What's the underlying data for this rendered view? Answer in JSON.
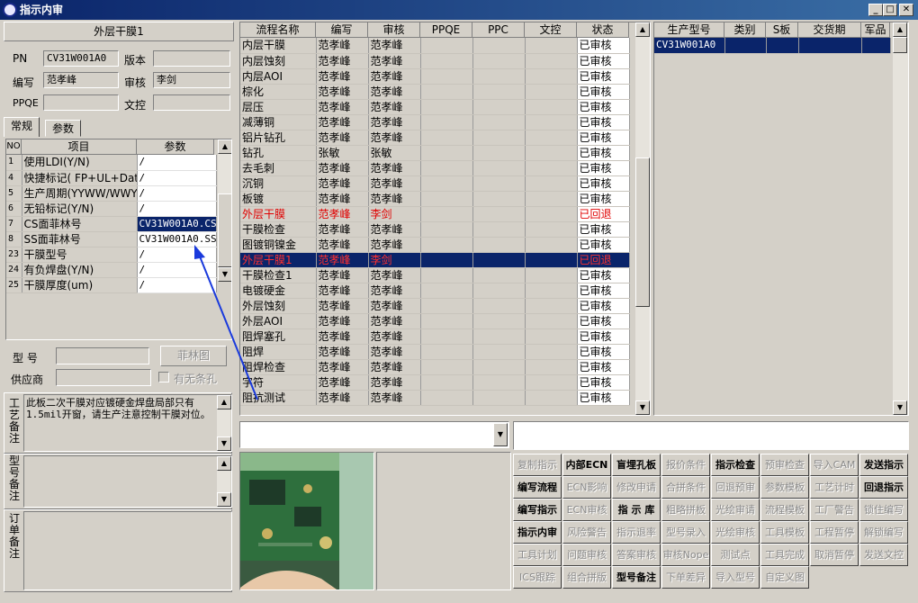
{
  "window": {
    "title": "指示内审"
  },
  "header": {
    "title": "外层干膜1"
  },
  "form": {
    "pn_label": "PN",
    "pn_value": "CV31W001A0",
    "version_label": "版本",
    "version_value": "",
    "author_label": "编写",
    "author_value": "范孝峰",
    "review_label": "审核",
    "review_value": "李剑",
    "ppqe_label": "PPQE",
    "ppqe_value": "",
    "control_label": "文控",
    "control_value": ""
  },
  "tabs": {
    "normal": "常规",
    "params": "参数"
  },
  "param_table": {
    "headers": [
      "NO",
      "项目",
      "参数"
    ],
    "rows": [
      {
        "no": "1",
        "item": "使用LDI(Y/N)",
        "value": "/"
      },
      {
        "no": "4",
        "item": "快捷标记( FP+UL+DateC",
        "value": "/"
      },
      {
        "no": "5",
        "item": "生产周期(YYWW/WWYY)",
        "value": "/"
      },
      {
        "no": "6",
        "item": "无铅标记(Y/N)",
        "value": "/"
      },
      {
        "no": "7",
        "item": "CS面菲林号",
        "value": "CV31W001A0.CS"
      },
      {
        "no": "8",
        "item": "SS面菲林号",
        "value": "CV31W001A0.SS"
      },
      {
        "no": "23",
        "item": "干膜型号",
        "value": "/"
      },
      {
        "no": "24",
        "item": "有负焊盘(Y/N)",
        "value": "/"
      },
      {
        "no": "25",
        "item": "干膜厚度(um)",
        "value": "/"
      }
    ]
  },
  "film": {
    "model_label": "型  号",
    "film_button": "菲林图",
    "supplier_label": "供应商",
    "no_strip_label": "有无条孔"
  },
  "remarks": {
    "process_label": "工艺备注",
    "process_text": "此板二次干膜对应镀硬金焊盘局部只有1.5mil开窗，请生产注意控制干膜对位。",
    "model_label": "型号备注",
    "model_text": "",
    "order_label": "订单备注",
    "order_text": ""
  },
  "flow_table": {
    "headers": [
      "流程名称",
      "编写",
      "审核",
      "PPQE",
      "PPC",
      "文控",
      "状态"
    ],
    "rows": [
      {
        "name": "内层干膜",
        "author": "范孝峰",
        "review": "范孝峰",
        "ppqe": "",
        "ppc": "",
        "ctrl": "",
        "status": "已审核",
        "style": "normal"
      },
      {
        "name": "内层蚀刻",
        "author": "范孝峰",
        "review": "范孝峰",
        "ppqe": "",
        "ppc": "",
        "ctrl": "",
        "status": "已审核",
        "style": "normal"
      },
      {
        "name": "内层AOI",
        "author": "范孝峰",
        "review": "范孝峰",
        "ppqe": "",
        "ppc": "",
        "ctrl": "",
        "status": "已审核",
        "style": "normal"
      },
      {
        "name": "棕化",
        "author": "范孝峰",
        "review": "范孝峰",
        "ppqe": "",
        "ppc": "",
        "ctrl": "",
        "status": "已审核",
        "style": "normal"
      },
      {
        "name": "层压",
        "author": "范孝峰",
        "review": "范孝峰",
        "ppqe": "",
        "ppc": "",
        "ctrl": "",
        "status": "已审核",
        "style": "normal"
      },
      {
        "name": "减薄铜",
        "author": "范孝峰",
        "review": "范孝峰",
        "ppqe": "",
        "ppc": "",
        "ctrl": "",
        "status": "已审核",
        "style": "normal"
      },
      {
        "name": "铝片钻孔",
        "author": "范孝峰",
        "review": "范孝峰",
        "ppqe": "",
        "ppc": "",
        "ctrl": "",
        "status": "已审核",
        "style": "normal"
      },
      {
        "name": "钻孔",
        "author": "张敏",
        "review": "张敏",
        "ppqe": "",
        "ppc": "",
        "ctrl": "",
        "status": "已审核",
        "style": "normal"
      },
      {
        "name": "去毛刺",
        "author": "范孝峰",
        "review": "范孝峰",
        "ppqe": "",
        "ppc": "",
        "ctrl": "",
        "status": "已审核",
        "style": "normal"
      },
      {
        "name": "沉铜",
        "author": "范孝峰",
        "review": "范孝峰",
        "ppqe": "",
        "ppc": "",
        "ctrl": "",
        "status": "已审核",
        "style": "normal"
      },
      {
        "name": "板镀",
        "author": "范孝峰",
        "review": "范孝峰",
        "ppqe": "",
        "ppc": "",
        "ctrl": "",
        "status": "已审核",
        "style": "normal"
      },
      {
        "name": "外层干膜",
        "author": "范孝峰",
        "review": "李剑",
        "ppqe": "",
        "ppc": "",
        "ctrl": "",
        "status": "已回退",
        "style": "red"
      },
      {
        "name": "干膜检查",
        "author": "范孝峰",
        "review": "范孝峰",
        "ppqe": "",
        "ppc": "",
        "ctrl": "",
        "status": "已审核",
        "style": "normal"
      },
      {
        "name": "图镀铜镍金",
        "author": "范孝峰",
        "review": "范孝峰",
        "ppqe": "",
        "ppc": "",
        "ctrl": "",
        "status": "已审核",
        "style": "normal"
      },
      {
        "name": "外层干膜1",
        "author": "范孝峰",
        "review": "李剑",
        "ppqe": "",
        "ppc": "",
        "ctrl": "",
        "status": "已回退",
        "style": "selected"
      },
      {
        "name": "干膜检查1",
        "author": "范孝峰",
        "review": "范孝峰",
        "ppqe": "",
        "ppc": "",
        "ctrl": "",
        "status": "已审核",
        "style": "normal"
      },
      {
        "name": "电镀硬金",
        "author": "范孝峰",
        "review": "范孝峰",
        "ppqe": "",
        "ppc": "",
        "ctrl": "",
        "status": "已审核",
        "style": "normal"
      },
      {
        "name": "外层蚀刻",
        "author": "范孝峰",
        "review": "范孝峰",
        "ppqe": "",
        "ppc": "",
        "ctrl": "",
        "status": "已审核",
        "style": "normal"
      },
      {
        "name": "外层AOI",
        "author": "范孝峰",
        "review": "范孝峰",
        "ppqe": "",
        "ppc": "",
        "ctrl": "",
        "status": "已审核",
        "style": "normal"
      },
      {
        "name": "阻焊塞孔",
        "author": "范孝峰",
        "review": "范孝峰",
        "ppqe": "",
        "ppc": "",
        "ctrl": "",
        "status": "已审核",
        "style": "normal"
      },
      {
        "name": "阻焊",
        "author": "范孝峰",
        "review": "范孝峰",
        "ppqe": "",
        "ppc": "",
        "ctrl": "",
        "status": "已审核",
        "style": "normal"
      },
      {
        "name": "阻焊检查",
        "author": "范孝峰",
        "review": "范孝峰",
        "ppqe": "",
        "ppc": "",
        "ctrl": "",
        "status": "已审核",
        "style": "normal"
      },
      {
        "name": "字符",
        "author": "范孝峰",
        "review": "范孝峰",
        "ppqe": "",
        "ppc": "",
        "ctrl": "",
        "status": "已审核",
        "style": "normal"
      },
      {
        "name": "阻抗测试",
        "author": "范孝峰",
        "review": "范孝峰",
        "ppqe": "",
        "ppc": "",
        "ctrl": "",
        "status": "已审核",
        "style": "normal"
      }
    ]
  },
  "order_table": {
    "headers": [
      "生产型号",
      "类别",
      "S板",
      "交货期",
      "军品"
    ],
    "rows": [
      {
        "model": "CV31W001A0",
        "type": "",
        "s": "",
        "due": "",
        "mil": ""
      }
    ]
  },
  "buttons": [
    {
      "label": "复制指示",
      "enabled": false
    },
    {
      "label": "内部ECN",
      "enabled": true
    },
    {
      "label": "盲埋孔板",
      "enabled": true
    },
    {
      "label": "报价条件",
      "enabled": false
    },
    {
      "label": "指示检查",
      "enabled": true
    },
    {
      "label": "预审检查",
      "enabled": false
    },
    {
      "label": "导入CAM",
      "enabled": false
    },
    {
      "label": "发送指示",
      "enabled": true
    },
    {
      "label": "编写流程",
      "enabled": true
    },
    {
      "label": "ECN影响",
      "enabled": false
    },
    {
      "label": "修改申请",
      "enabled": false
    },
    {
      "label": "合拼条件",
      "enabled": false
    },
    {
      "label": "回退预审",
      "enabled": false
    },
    {
      "label": "参数模板",
      "enabled": false
    },
    {
      "label": "工艺计时",
      "enabled": false
    },
    {
      "label": "回退指示",
      "enabled": true
    },
    {
      "label": "编写指示",
      "enabled": true
    },
    {
      "label": "ECN审核",
      "enabled": false
    },
    {
      "label": "指 示 库",
      "enabled": true
    },
    {
      "label": "粗略拼板",
      "enabled": false
    },
    {
      "label": "光绘审请",
      "enabled": false
    },
    {
      "label": "流程模板",
      "enabled": false
    },
    {
      "label": "工厂警告",
      "enabled": false
    },
    {
      "label": "锁住编写",
      "enabled": false
    },
    {
      "label": "指示内审",
      "enabled": true
    },
    {
      "label": "风险警告",
      "enabled": false
    },
    {
      "label": "指示退率",
      "enabled": false
    },
    {
      "label": "型号录入",
      "enabled": false
    },
    {
      "label": "光绘审核",
      "enabled": false
    },
    {
      "label": "工具模板",
      "enabled": false
    },
    {
      "label": "工程暂停",
      "enabled": false
    },
    {
      "label": "解锁编写",
      "enabled": false
    },
    {
      "label": "工具计划",
      "enabled": false
    },
    {
      "label": "问题审核",
      "enabled": false
    },
    {
      "label": "答案审核",
      "enabled": false
    },
    {
      "label": "审核Nope",
      "enabled": false
    },
    {
      "label": "测试点",
      "enabled": false
    },
    {
      "label": "工具完成",
      "enabled": false
    },
    {
      "label": "取消暂停",
      "enabled": false
    },
    {
      "label": "发送文控",
      "enabled": false
    },
    {
      "label": "ICS跟踪",
      "enabled": false
    },
    {
      "label": "组合拼版",
      "enabled": false
    },
    {
      "label": "型号备注",
      "enabled": true
    },
    {
      "label": "下单差异",
      "enabled": false
    },
    {
      "label": "导入型号",
      "enabled": false
    },
    {
      "label": "自定义图",
      "enabled": false
    }
  ],
  "icons": {
    "app": "app-logo-icon",
    "minimize": "minimize-icon",
    "maximize": "maximize-icon",
    "close": "close-icon",
    "arrow": "annotation-arrow",
    "photo": "pcb-photo"
  },
  "colors": {
    "title_bar": "#0a246a",
    "selected_row": "#0a246a",
    "rejected_text": "#e00000",
    "window_bg": "#d4d0c8"
  }
}
